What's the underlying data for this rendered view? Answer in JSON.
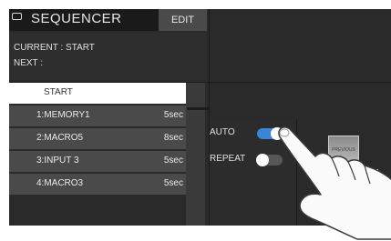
{
  "header": {
    "title": "SEQUENCER",
    "edit_label": "EDIT"
  },
  "status": {
    "current": "CURRENT : START",
    "next": "NEXT       :"
  },
  "list": [
    {
      "name": "START",
      "duration": "",
      "selected": true
    },
    {
      "name": "1:MEMORY1",
      "duration": "5sec"
    },
    {
      "name": "2:MACRO5",
      "duration": "8sec"
    },
    {
      "name": "3:INPUT 3",
      "duration": "5sec"
    },
    {
      "name": "4:MACRO3",
      "duration": "5sec"
    }
  ],
  "controls": {
    "auto": {
      "label": "AUTO",
      "on": true
    },
    "repeat": {
      "label": "REPEAT",
      "on": false
    }
  },
  "preview": {
    "label": "PREVIOUS"
  },
  "colors": {
    "accent": "#3a85d6",
    "screen_bg": "#2a2a2a",
    "row_bg": "#4a4a4a"
  }
}
